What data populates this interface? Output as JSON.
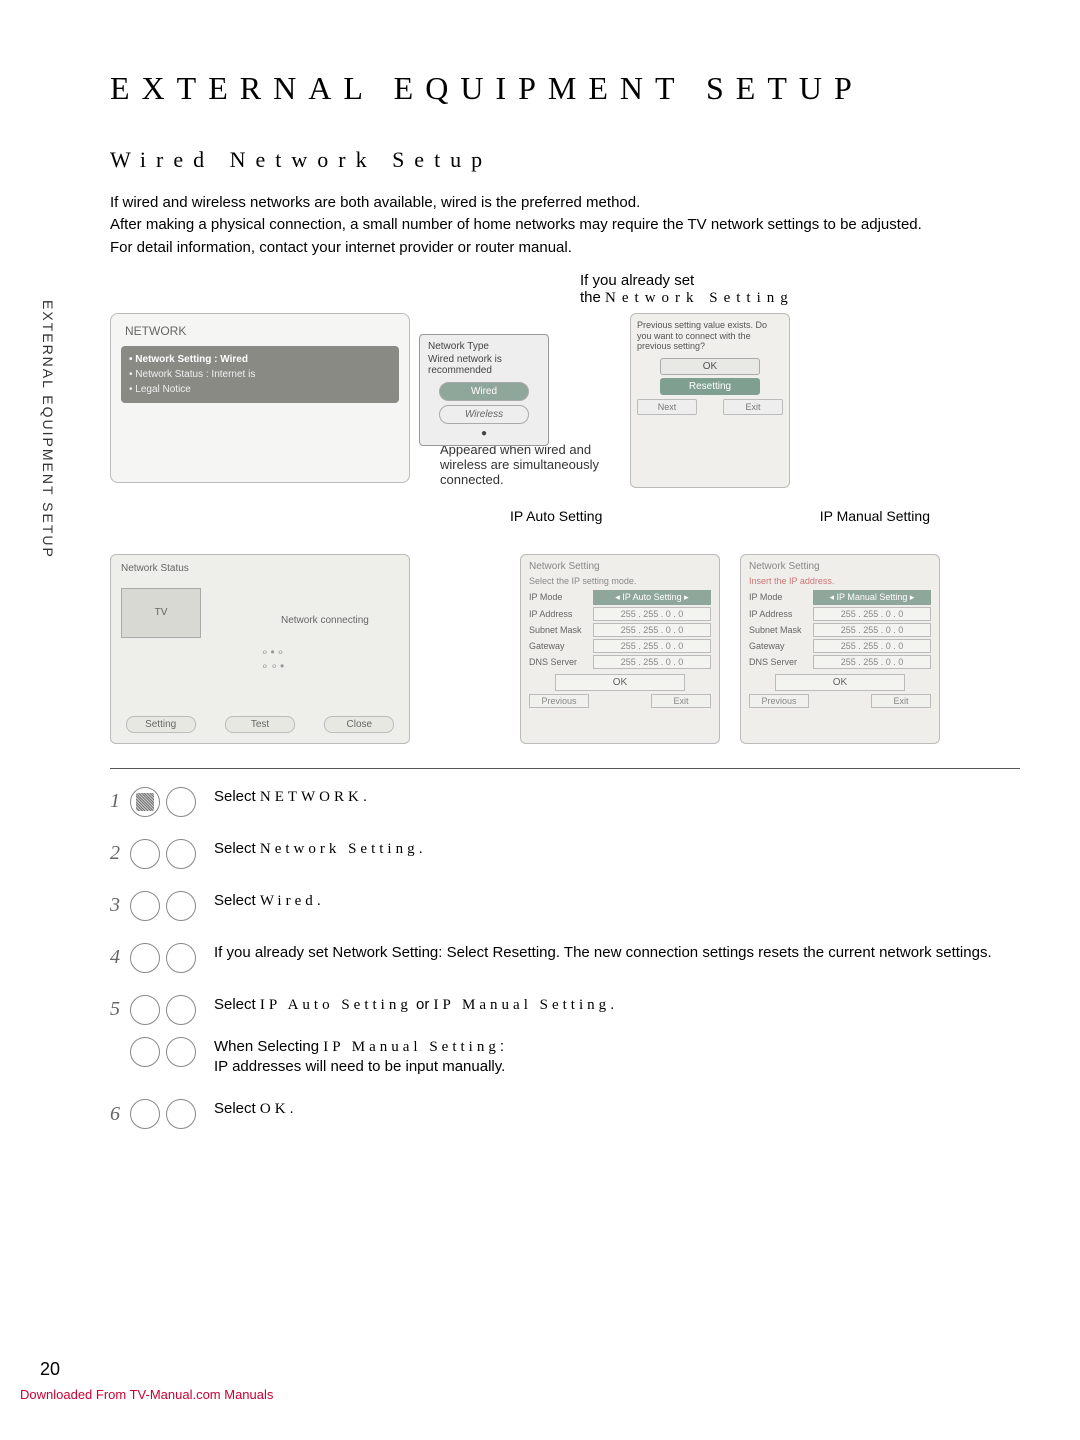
{
  "vtab": "EXTERNAL EQUIPMENT SETUP",
  "h1": "EXTERNAL EQUIPMENT SETUP",
  "h2": "Wired Network Setup",
  "intro": {
    "l1": "If wired and wireless networks are both available, wired is the preferred method.",
    "l2": "After making a physical connection, a small number of home networks may require the TV network settings to be adjusted.",
    "l3": "For detail information, contact your internet provider or router manual."
  },
  "already": {
    "pre": "If you already set",
    "pre2": "the",
    "ns": "Network Setting"
  },
  "menu": {
    "title": "NETWORK",
    "items": {
      "a": "• Network Setting   : Wired",
      "b": "• Network Status      : Internet is",
      "c": "• Legal Notice"
    },
    "popup": {
      "title": "Network Type",
      "rec": "Wired network is recommended",
      "wired": "Wired",
      "wireless": "Wireless"
    },
    "caption": "Appeared when wired and wireless are simultaneously connected."
  },
  "dlg": {
    "msg": "Previous setting value exists. Do you want to connect with the previous setting?",
    "ok": "OK",
    "reset": "Resetting",
    "next": "Next",
    "exit": "Exit"
  },
  "status": {
    "title": "Network Status",
    "tv": "TV",
    "conn": "Network connecting",
    "setting": "Setting",
    "test": "Test",
    "close": "Close"
  },
  "ipcols": {
    "auto": "IP Auto Setting",
    "manual": "IP Manual Setting"
  },
  "net": {
    "title": "Network Setting",
    "sub_auto": "Select the IP setting mode.",
    "sub_manual": "Insert the IP address.",
    "fields": {
      "mode": "IP Mode",
      "ip": "IP Address",
      "mask": "Subnet Mask",
      "gw": "Gateway",
      "dns": "DNS Server"
    },
    "mode_auto": "◂ IP Auto Setting ▸",
    "mode_manual": "◂ IP Manual Setting ▸",
    "val": "255 . 255 . 0 . 0",
    "ok": "OK",
    "prev": "Previous",
    "exit": "Exit"
  },
  "steps": {
    "s1": {
      "pre": "Select ",
      "kw": "NETWORK",
      "post": "."
    },
    "s2": {
      "pre": "Select ",
      "kw": "Network Setting",
      "post": "."
    },
    "s3": {
      "pre": "Select ",
      "kw": "Wired",
      "post": "."
    },
    "s4": "If you already set Network Setting: Select Resetting. The new connection settings resets the current network settings.",
    "s5": {
      "pre": "Select ",
      "kw1": "IP Auto Setting",
      "mid": " or ",
      "kw2": "IP Manual Setting",
      "post": "."
    },
    "s5b": {
      "pre": "When Selecting ",
      "kw": "IP Manual Setting",
      "post": ":",
      "line2": "IP addresses will need to be input manually."
    },
    "s6": {
      "pre": "Select ",
      "kw": "OK",
      "post": "."
    }
  },
  "pagenum": "20",
  "dl": "Downloaded From TV-Manual.com Manuals"
}
